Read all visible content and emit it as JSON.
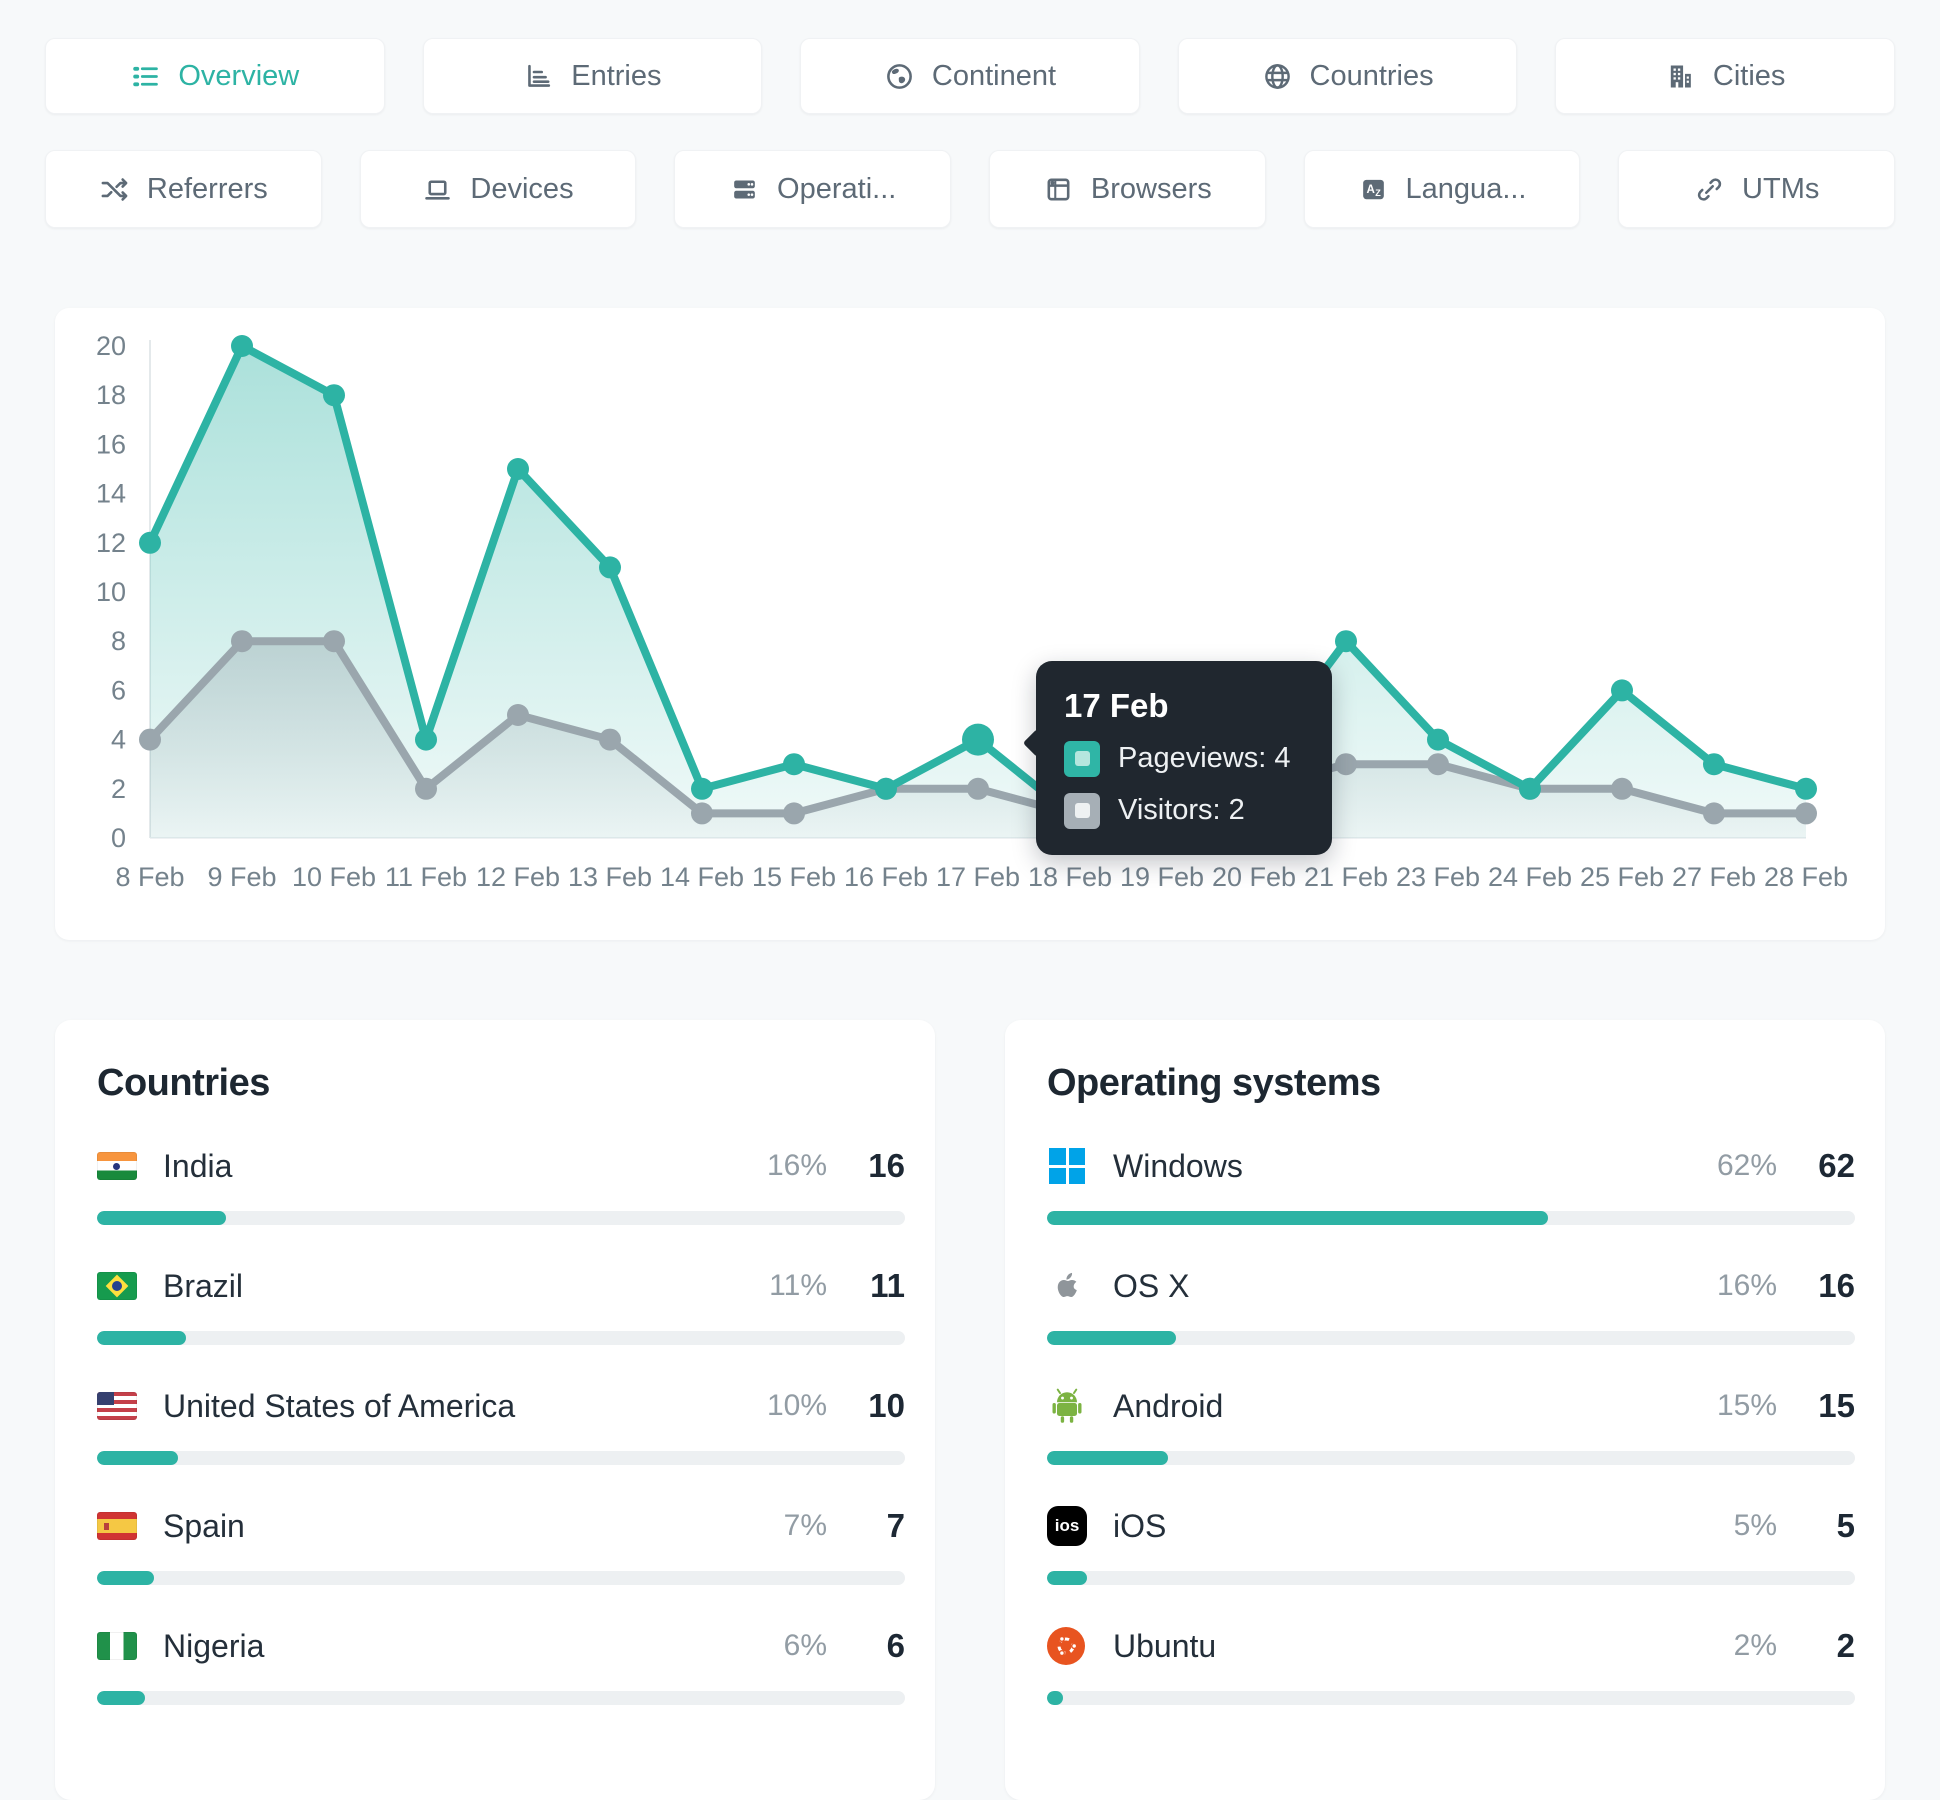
{
  "accent_color": "#2db3a4",
  "tabs_row1": [
    {
      "label": "Overview",
      "icon": "list-icon",
      "active": true
    },
    {
      "label": "Entries",
      "icon": "bar-chart-icon",
      "active": false
    },
    {
      "label": "Continent",
      "icon": "earth-icon",
      "active": false
    },
    {
      "label": "Countries",
      "icon": "globe-icon",
      "active": false
    },
    {
      "label": "Cities",
      "icon": "buildings-icon",
      "active": false
    }
  ],
  "tabs_row2": [
    {
      "label": "Referrers",
      "icon": "shuffle-icon"
    },
    {
      "label": "Devices",
      "icon": "laptop-icon"
    },
    {
      "label": "Operati...",
      "icon": "server-icon"
    },
    {
      "label": "Browsers",
      "icon": "browser-window-icon"
    },
    {
      "label": "Langua...",
      "icon": "translate-icon"
    },
    {
      "label": "UTMs",
      "icon": "link-icon"
    }
  ],
  "chart_data": {
    "type": "line",
    "categories": [
      "8 Feb",
      "9 Feb",
      "10 Feb",
      "11 Feb",
      "12 Feb",
      "13 Feb",
      "14 Feb",
      "15 Feb",
      "16 Feb",
      "17 Feb",
      "18 Feb",
      "19 Feb",
      "20 Feb",
      "21 Feb",
      "23 Feb",
      "24 Feb",
      "25 Feb",
      "27 Feb",
      "28 Feb"
    ],
    "series": [
      {
        "name": "Pageviews",
        "color": "#2db3a4",
        "values": [
          12,
          20,
          18,
          4,
          15,
          11,
          2,
          3,
          2,
          4,
          1,
          1,
          3,
          8,
          4,
          2,
          6,
          3,
          2
        ]
      },
      {
        "name": "Visitors",
        "color": "#9aa6ad",
        "values": [
          4,
          8,
          8,
          2,
          5,
          4,
          1,
          1,
          2,
          2,
          1,
          1,
          2,
          3,
          3,
          2,
          2,
          1,
          1
        ]
      }
    ],
    "ylim": [
      0,
      20
    ],
    "ytick_step": 2,
    "grid": false,
    "legend_position": "none",
    "highlight_index": 9
  },
  "tooltip": {
    "title": "17 Feb",
    "items": [
      {
        "series": "Pageviews",
        "value": 4,
        "color": "#2fb5a6",
        "inner_color": "#b5e6de"
      },
      {
        "series": "Visitors",
        "value": 2,
        "color": "#a6afb6",
        "inner_color": "#eef1f2"
      }
    ]
  },
  "countries": {
    "title": "Countries",
    "rows": [
      {
        "name": "India",
        "flag": "india-flag",
        "percent": "16%",
        "percent_value": 16,
        "count": "16"
      },
      {
        "name": "Brazil",
        "flag": "brazil-flag",
        "percent": "11%",
        "percent_value": 11,
        "count": "11"
      },
      {
        "name": "United States of America",
        "flag": "usa-flag",
        "percent": "10%",
        "percent_value": 10,
        "count": "10"
      },
      {
        "name": "Spain",
        "flag": "spain-flag",
        "percent": "7%",
        "percent_value": 7,
        "count": "7"
      },
      {
        "name": "Nigeria",
        "flag": "nigeria-flag",
        "percent": "6%",
        "percent_value": 6,
        "count": "6"
      }
    ]
  },
  "operating_systems": {
    "title": "Operating systems",
    "ios_badge_text": "ios",
    "rows": [
      {
        "name": "Windows",
        "icon": "windows-icon",
        "percent": "62%",
        "percent_value": 62,
        "count": "62"
      },
      {
        "name": "OS X",
        "icon": "apple-icon",
        "percent": "16%",
        "percent_value": 16,
        "count": "16"
      },
      {
        "name": "Android",
        "icon": "android-icon",
        "percent": "15%",
        "percent_value": 15,
        "count": "15"
      },
      {
        "name": "iOS",
        "icon": "ios-icon",
        "percent": "5%",
        "percent_value": 5,
        "count": "5"
      },
      {
        "name": "Ubuntu",
        "icon": "ubuntu-icon",
        "percent": "2%",
        "percent_value": 2,
        "count": "2"
      }
    ]
  }
}
